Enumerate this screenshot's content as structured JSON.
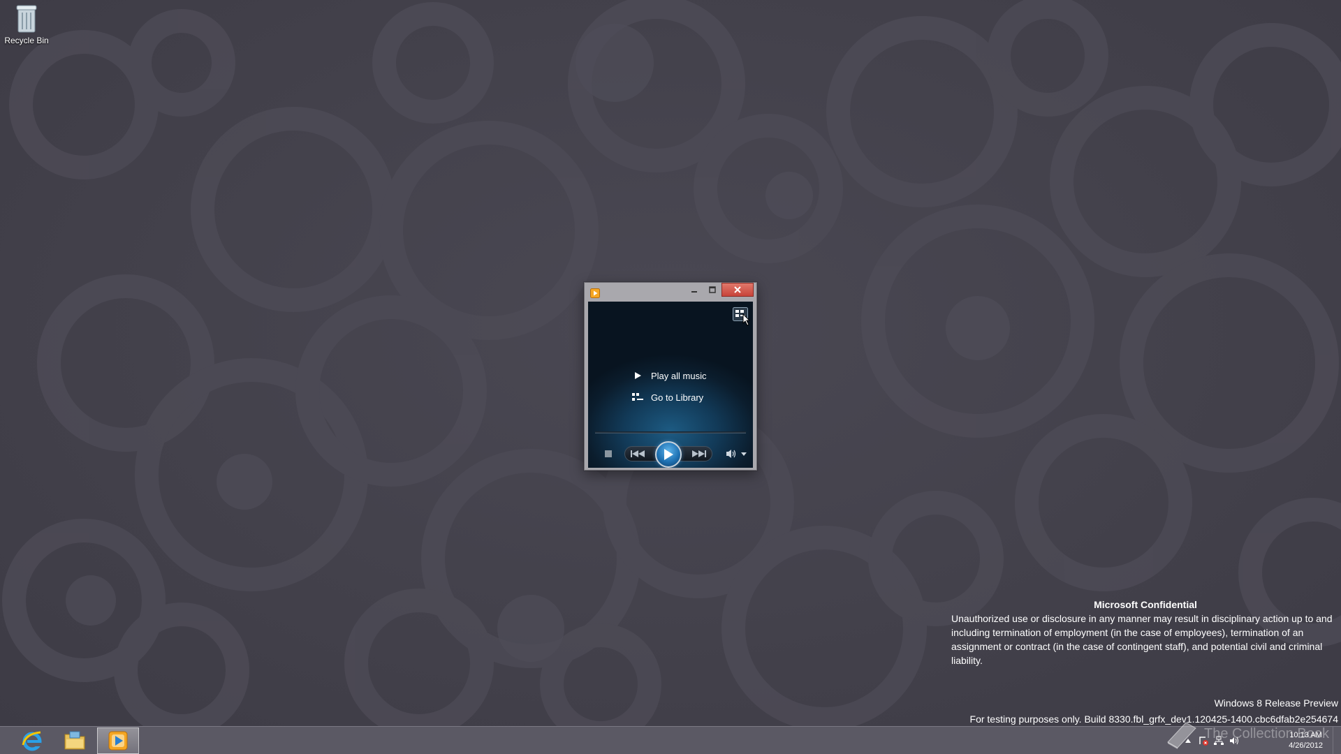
{
  "desktop": {
    "icons": [
      {
        "label": "Recycle Bin",
        "icon": "recycle-bin-icon"
      }
    ]
  },
  "media_player": {
    "app_icon": "windows-media-player-icon",
    "caption_buttons": [
      "minimize-icon",
      "maximize-icon",
      "close-icon"
    ],
    "switch_to_library_icon": "switch-to-library-icon",
    "links": [
      {
        "label": "Play all music",
        "icon": "play-icon"
      },
      {
        "label": "Go to Library",
        "icon": "library-icon"
      }
    ],
    "controls": [
      "stop-icon",
      "previous-icon",
      "play-icon",
      "next-icon",
      "volume-icon",
      "chevron-down-icon"
    ]
  },
  "watermark": {
    "title": "Microsoft Confidential",
    "body": "Unauthorized use or disclosure in any manner may result in disciplinary action up to and including termination of employment (in the case of employees), termination of an assignment or contract (in the case of contingent staff), and potential civil and criminal liability.",
    "edition": "Windows 8 Release Preview",
    "build": "For testing purposes only. Build 8330.fbl_grfx_dev1.120425-1400.cbc6dfab2e254674"
  },
  "taskbar": {
    "pinned": [
      {
        "name": "Internet Explorer",
        "icon": "internet-explorer-icon"
      },
      {
        "name": "File Explorer",
        "icon": "file-explorer-icon"
      },
      {
        "name": "Windows Media Player",
        "icon": "windows-media-player-icon",
        "active": true
      }
    ],
    "tray_icons": [
      "chevron-up-icon",
      "action-center-icon",
      "network-icon",
      "volume-icon"
    ],
    "clock": {
      "time": "10:13 AM",
      "date": "4/26/2012"
    }
  },
  "overlay_watermark": {
    "text": "The Collection Book",
    "icon": "book-icon"
  },
  "colors": {
    "desktop": "#43414b",
    "taskbar": "#5b5964",
    "close_button": "#c8443a",
    "player_accent": "#1f72b4"
  }
}
